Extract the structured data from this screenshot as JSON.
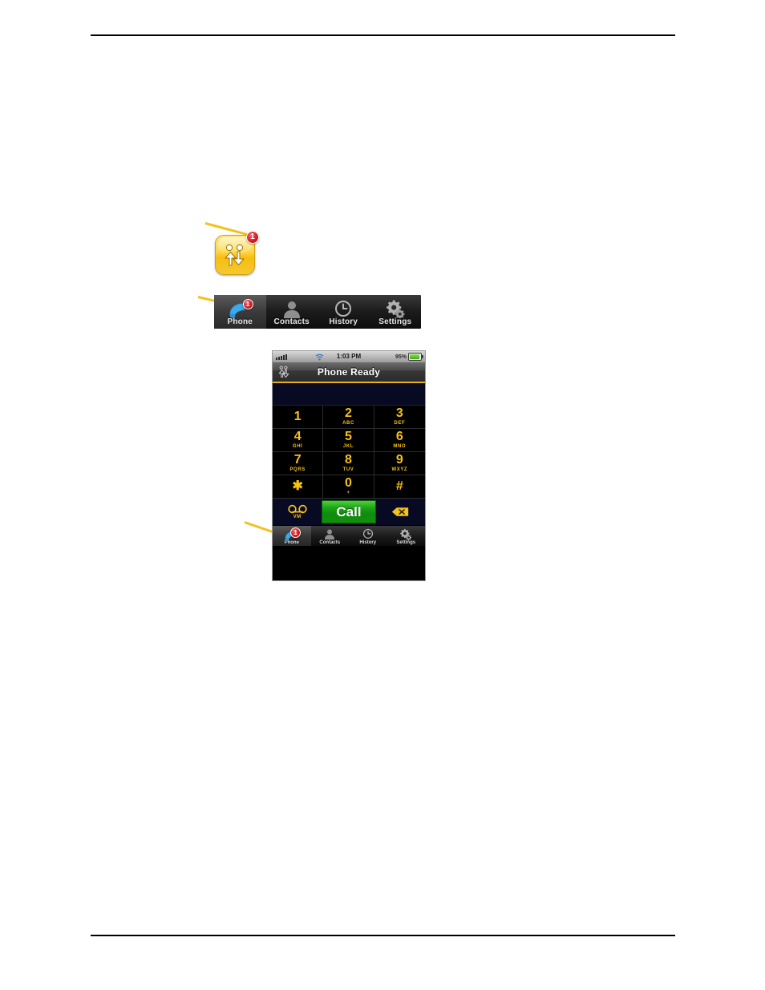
{
  "document": {
    "rules": {
      "top": true,
      "bottom": true
    }
  },
  "presence_icon": {
    "name": "availability-icon",
    "badge_count": "1",
    "color": "#f7bd10"
  },
  "toolbar": {
    "tabs": [
      {
        "label": "Phone",
        "icon": "handset-icon",
        "selected": true,
        "badge": "1"
      },
      {
        "label": "Contacts",
        "icon": "person-icon",
        "selected": false,
        "badge": ""
      },
      {
        "label": "History",
        "icon": "clock-icon",
        "selected": false,
        "badge": ""
      },
      {
        "label": "Settings",
        "icon": "gear-icon",
        "selected": false,
        "badge": ""
      }
    ]
  },
  "phone": {
    "status_bar": {
      "signal_icon": "signal-bars-icon",
      "wifi_icon": "wifi-icon",
      "time": "1:03 PM",
      "battery_percent": "95%",
      "battery_icon": "battery-icon"
    },
    "navbar": {
      "title": "Phone Ready",
      "presence_icon": "availability-icon"
    },
    "dial_display": {
      "value": ""
    },
    "keypad": [
      {
        "digit": "1",
        "letters": ""
      },
      {
        "digit": "2",
        "letters": "ABC"
      },
      {
        "digit": "3",
        "letters": "DEF"
      },
      {
        "digit": "4",
        "letters": "GHI"
      },
      {
        "digit": "5",
        "letters": "JKL"
      },
      {
        "digit": "6",
        "letters": "MNO"
      },
      {
        "digit": "7",
        "letters": "PQRS"
      },
      {
        "digit": "8",
        "letters": "TUV"
      },
      {
        "digit": "9",
        "letters": "WXYZ"
      },
      {
        "digit": "✱",
        "letters": ""
      },
      {
        "digit": "0",
        "letters": "+"
      },
      {
        "digit": "#",
        "letters": ""
      }
    ],
    "actions": {
      "voicemail_icon": "voicemail-icon",
      "voicemail_label": "VM",
      "call_label": "Call",
      "call_color": "#17a113",
      "delete_icon": "backspace-icon"
    },
    "tabbar": {
      "tabs": [
        {
          "label": "Phone",
          "icon": "handset-icon",
          "selected": true,
          "badge": "1"
        },
        {
          "label": "Contacts",
          "icon": "person-icon",
          "selected": false,
          "badge": ""
        },
        {
          "label": "History",
          "icon": "clock-icon",
          "selected": false,
          "badge": ""
        },
        {
          "label": "Settings",
          "icon": "gear-icon",
          "selected": false,
          "badge": ""
        }
      ]
    }
  },
  "annotations": {
    "color": "#f5c11a",
    "leaders": [
      {
        "name": "leader-to-presence-icon"
      },
      {
        "name": "leader-to-phone-tab"
      },
      {
        "name": "leader-to-voicemail-button"
      }
    ]
  }
}
